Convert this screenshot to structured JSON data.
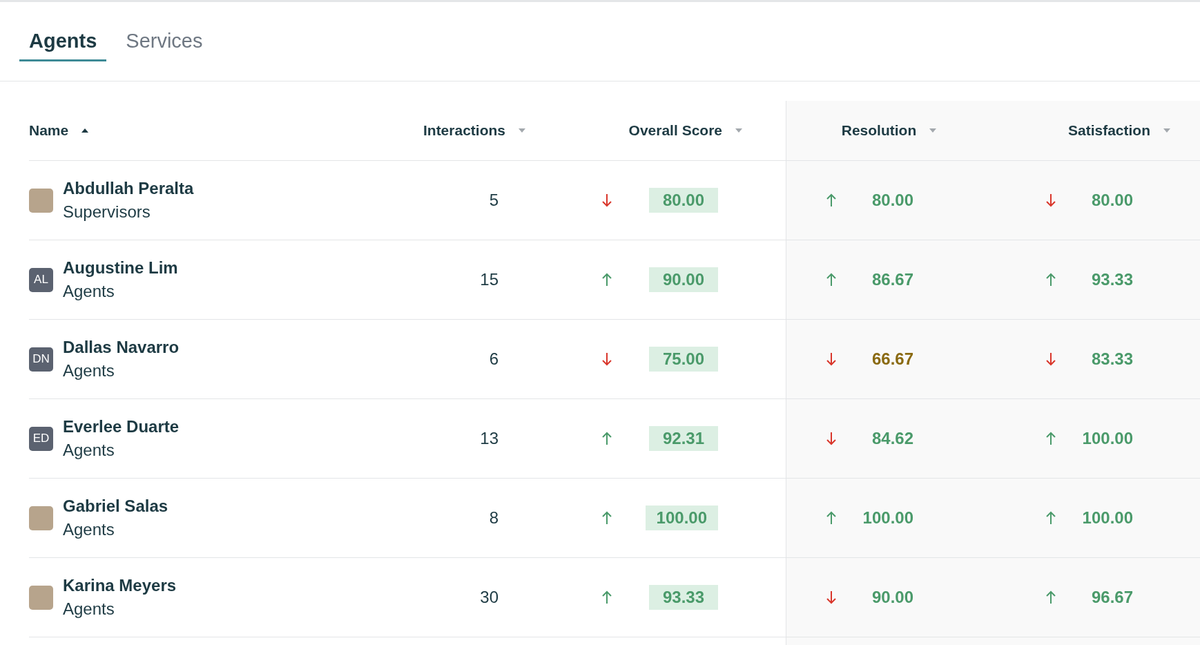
{
  "tabs": [
    {
      "label": "Agents",
      "selected": true
    },
    {
      "label": "Services",
      "selected": false
    }
  ],
  "columns": [
    {
      "label": "Name",
      "sorted": true
    },
    {
      "label": "Interactions",
      "sorted": false
    },
    {
      "label": "Overall Score",
      "sorted": false
    },
    {
      "label": "Resolution",
      "sorted": false
    },
    {
      "label": "Satisfaction",
      "sorted": false
    }
  ],
  "rows": [
    {
      "name": "Abdullah Peralta",
      "group": "Supervisors",
      "avatar": {
        "photo": true
      },
      "interactions": "5",
      "overall": {
        "rising": false,
        "value": "80.00",
        "warning": false
      },
      "resolution": {
        "rising": true,
        "value": "80.00",
        "warning": false
      },
      "satisfaction": {
        "rising": false,
        "value": "80.00",
        "warning": false
      }
    },
    {
      "name": "Augustine Lim",
      "group": "Agents",
      "avatar": {
        "photo": false,
        "initials": "AL"
      },
      "interactions": "15",
      "overall": {
        "rising": true,
        "value": "90.00",
        "warning": false
      },
      "resolution": {
        "rising": true,
        "value": "86.67",
        "warning": false
      },
      "satisfaction": {
        "rising": true,
        "value": "93.33",
        "warning": false
      }
    },
    {
      "name": "Dallas Navarro",
      "group": "Agents",
      "avatar": {
        "photo": false,
        "initials": "DN"
      },
      "interactions": "6",
      "overall": {
        "rising": false,
        "value": "75.00",
        "warning": false
      },
      "resolution": {
        "rising": false,
        "value": "66.67",
        "warning": true
      },
      "satisfaction": {
        "rising": false,
        "value": "83.33",
        "warning": false
      }
    },
    {
      "name": "Everlee Duarte",
      "group": "Agents",
      "avatar": {
        "photo": false,
        "initials": "ED"
      },
      "interactions": "13",
      "overall": {
        "rising": true,
        "value": "92.31",
        "warning": false
      },
      "resolution": {
        "rising": false,
        "value": "84.62",
        "warning": false
      },
      "satisfaction": {
        "rising": true,
        "value": "100.00",
        "warning": false
      }
    },
    {
      "name": "Gabriel Salas",
      "group": "Agents",
      "avatar": {
        "photo": true
      },
      "interactions": "8",
      "overall": {
        "rising": true,
        "value": "100.00",
        "warning": false
      },
      "resolution": {
        "rising": true,
        "value": "100.00",
        "warning": false
      },
      "satisfaction": {
        "rising": true,
        "value": "100.00",
        "warning": false
      }
    },
    {
      "name": "Karina Meyers",
      "group": "Agents",
      "avatar": {
        "photo": true
      },
      "interactions": "30",
      "overall": {
        "rising": true,
        "value": "93.33",
        "warning": false
      },
      "resolution": {
        "rising": false,
        "value": "90.00",
        "warning": false
      },
      "satisfaction": {
        "rising": true,
        "value": "96.67",
        "warning": false
      }
    }
  ]
}
